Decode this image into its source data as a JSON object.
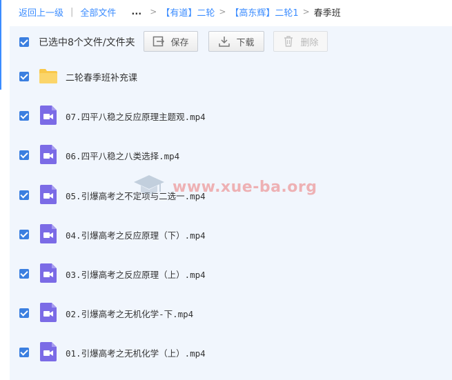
{
  "breadcrumb": {
    "back": "返回上一级",
    "all_files": "全部文件",
    "ellipsis": "...",
    "path1": "【有道】二轮",
    "path2": "【高东辉】二轮1",
    "current": "春季班"
  },
  "toolbar": {
    "selection_text": "已选中8个文件/文件夹",
    "save_label": "保存",
    "download_label": "下载",
    "delete_label": "删除"
  },
  "files": [
    {
      "name": "二轮春季班补充课",
      "type": "folder"
    },
    {
      "name": "07.四平八稳之反应原理主题观.mp4",
      "type": "video"
    },
    {
      "name": "06.四平八稳之八类选择.mp4",
      "type": "video"
    },
    {
      "name": "05.引爆高考之不定项与二选一.mp4",
      "type": "video"
    },
    {
      "name": "04.引爆高考之反应原理（下）.mp4",
      "type": "video"
    },
    {
      "name": "03.引爆高考之反应原理（上）.mp4",
      "type": "video"
    },
    {
      "name": "02.引爆高考之无机化学-下.mp4",
      "type": "video"
    },
    {
      "name": "01.引爆高考之无机化学（上）.mp4",
      "type": "video"
    }
  ],
  "watermark": "www.xue-ba.org",
  "colors": {
    "accent": "#3b8cff",
    "checkbox": "#3b7fe0",
    "video_icon": "#7b6be6",
    "folder": "#f9c84a"
  }
}
